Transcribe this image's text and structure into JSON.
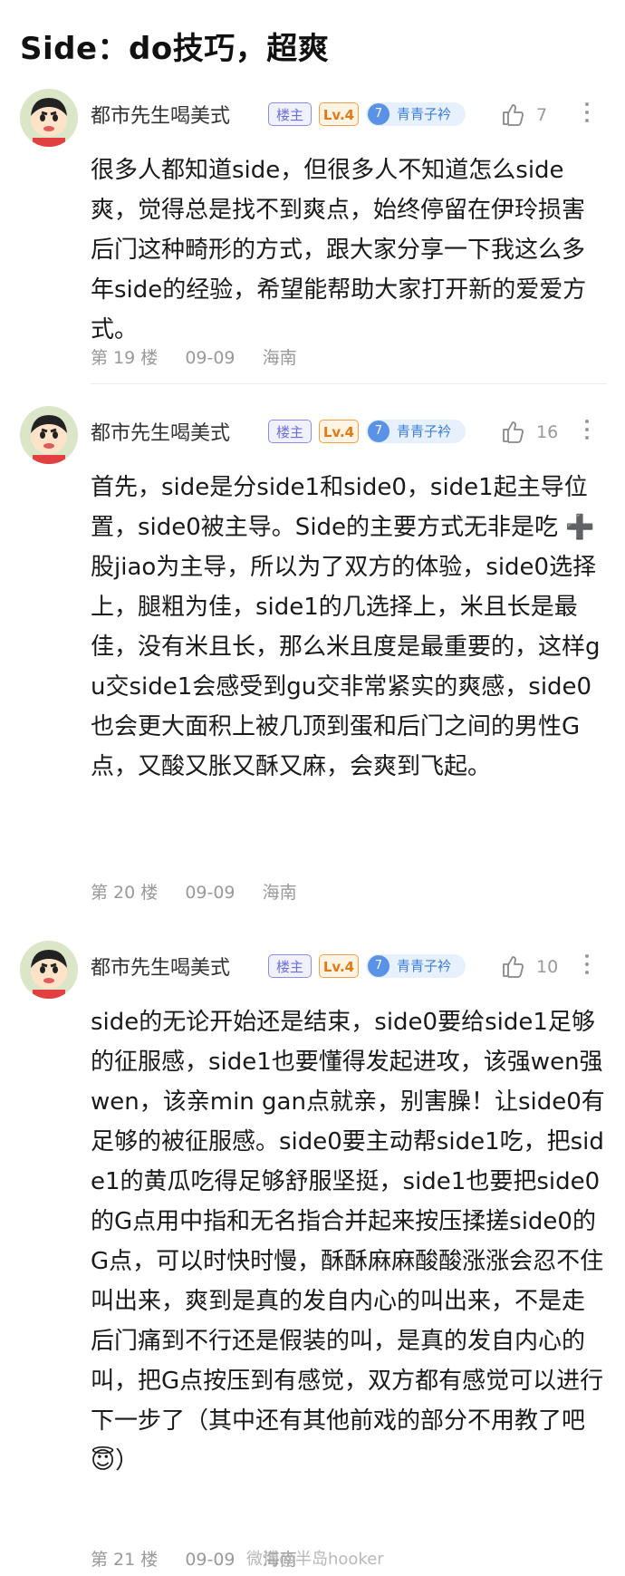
{
  "title": "Side：do技巧，超爽",
  "posts": [
    {
      "username": "都市先生喝美式",
      "host_badge": "楼主",
      "level_badge": "Lv.4",
      "group_number": "7",
      "group_badge": "青青子衿",
      "likes": "7",
      "content": "很多人都知道side，但很多人不知道怎么side爽，觉得总是找不到爽点，始终停留在伊玲损害后门这种畸形的方式，跟大家分享一下我这么多年side的经验，希望能帮助大家打开新的爱爱方式。",
      "floor": "第 19 楼",
      "date": "09-09",
      "location": "海南"
    },
    {
      "username": "都市先生喝美式",
      "host_badge": "楼主",
      "level_badge": "Lv.4",
      "group_number": "7",
      "group_badge": "青青子衿",
      "likes": "16",
      "content": "首先，side是分side1和side0，side1起主导位置，side0被主导。Side的主要方式无非是吃 ➕ 股jiao为主导，所以为了双方的体验，side0选择上，腿粗为佳，side1的几选择上，米且长是最佳，没有米且长，那么米且度是最重要的，这样gu交side1会感受到gu交非常紧实的爽感，side0也会更大面积上被几顶到蛋和后门之间的男性G点，又酸又胀又酥又麻，会爽到飞起。",
      "floor": "第 20 楼",
      "date": "09-09",
      "location": "海南"
    },
    {
      "username": "都市先生喝美式",
      "host_badge": "楼主",
      "level_badge": "Lv.4",
      "group_number": "7",
      "group_badge": "青青子衿",
      "likes": "10",
      "content": "side的无论开始还是结束，side0要给side1足够的征服感，side1也要懂得发起进攻，该强wen强wen，该亲min gan点就亲，别害臊！让side0有足够的被征服感。side0要主动帮side1吃，把side1的黄瓜吃得足够舒服坚挺，side1也要把side0的G点用中指和无名指合并起来按压揉搓side0的G点，可以时快时慢，酥酥麻麻酸酸涨涨会忍不住叫出来，爽到是真的发自内心的叫出来，不是走后门痛到不行还是假装的叫，是真的发自内心的叫，把G点按压到有感觉，双方都有感觉可以进行下一步了（其中还有其他前戏的部分不用教了吧😇）",
      "floor": "第 21 楼",
      "date": "09-09",
      "location": "海南"
    }
  ],
  "watermark": "微博@半岛hooker"
}
